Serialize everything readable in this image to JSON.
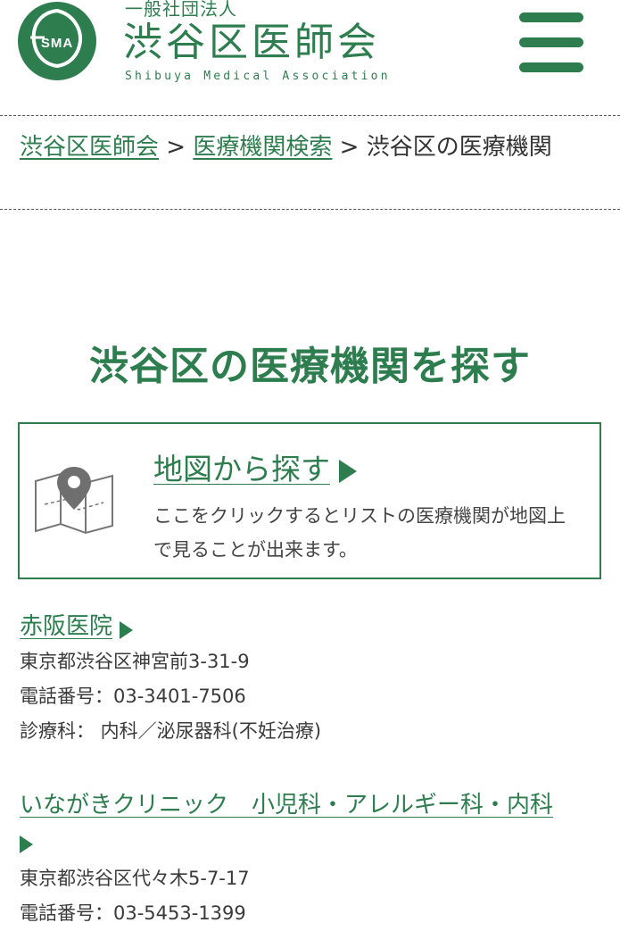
{
  "header": {
    "logo_text": "SMA",
    "org_type": "一般社団法人",
    "org_name": "渋谷区医師会",
    "org_name_en": "Shibuya Medical Association",
    "menu_icon": "hamburger-menu-icon"
  },
  "breadcrumb": {
    "items": [
      "渋谷区医師会",
      "医療機関検索"
    ],
    "separator": ">",
    "current": "渋谷区の医療機関"
  },
  "page_title": "渋谷区の医療機関を探す",
  "map_search": {
    "icon": "map-pin-icon",
    "title": "地図から探す",
    "description": "ここをクリックするとリストの医療機関が地図上で見ることが出来ます。"
  },
  "clinics": [
    {
      "name": "赤阪医院",
      "address": "東京都渋谷区神宮前3-31-9",
      "phone": "電話番号：03-3401-7506",
      "departments": "診療科： 内科／泌尿器科(不妊治療)"
    },
    {
      "name": "いながきクリニック　小児科・アレルギー科・内科",
      "address": "東京都渋谷区代々木5-7-17",
      "phone": "電話番号：03-5453-1399"
    }
  ],
  "colors": {
    "brand_green": "#2e7d4f",
    "text": "#3a3a3a"
  }
}
